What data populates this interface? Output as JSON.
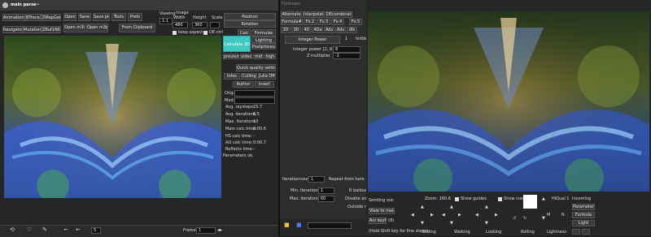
{
  "window": {
    "title": "main parse~"
  },
  "menu": [
    "Animations",
    "BTrace2",
    "ZMapGen",
    "Open",
    "Save",
    "Save pic",
    "Tools",
    "Prefs"
  ],
  "menu2": [
    "Navigator",
    "MutaGen",
    "ZBuf16Bit",
    "Open m3i",
    "Open m3p",
    "From Clipboard"
  ],
  "viewing": {
    "label": "Viewing",
    "zoom": "1:1",
    "image_label": "Image",
    "width_label": "Width",
    "width": "480",
    "height_label": "Height",
    "height": "360",
    "scale_label": "Scale",
    "keep_aspect": "keep aspect",
    "de_label": "DE:ctrl"
  },
  "side_tabs": [
    "Position",
    "Rotation",
    "Calc",
    "Formulas",
    "Lighting",
    "Postprocess"
  ],
  "calc_button": "Calculate 3D",
  "quality": [
    "preview",
    "video",
    "mid",
    "high"
  ],
  "quick_quality": "Quick quality settings",
  "sub_tabs": [
    "Infos",
    "Culling",
    "Julia Off"
  ],
  "author_btn": "Author",
  "insert_btn": "insert",
  "orig_label": "Orig:",
  "mod_label": "Mod:",
  "stats": [
    {
      "k": "Avg. raysteps:",
      "v": "23.7"
    },
    {
      "k": "Avg. iterations:",
      "v": "6.5"
    },
    {
      "k": "Max. iterations:",
      "v": "13"
    },
    {
      "k": "Main calc time:",
      "v": "0:00.6"
    },
    {
      "k": "HS calc time:",
      "v": "-"
    },
    {
      "k": "AO calc time:",
      "v": "0:00.7"
    },
    {
      "k": "Reflects time:",
      "v": "-"
    }
  ],
  "params_ok": "Parameters ok.",
  "frame_label": "Frame:",
  "frame_value": "1",
  "toolbar_value": "5",
  "formulas_window": {
    "title": "Formulas"
  },
  "formula_tabs": [
    "Alternate",
    "Interpolate",
    "DEcombinate"
  ],
  "formula_row2": [
    "Formula#",
    "Fo.2",
    "Fo.3",
    "Fo.4",
    "Fo.5"
  ],
  "formula_row3": [
    "3D",
    "3D",
    "4D",
    "4Da",
    "Ads",
    "Ads",
    "dlk"
  ],
  "formula_name": "Integer Power",
  "formula_num": "1",
  "hide_label": "hidde",
  "integer_power_label": "Integer power [2..9]",
  "integer_power": "8",
  "z_mult_label": "Z multiplier",
  "z_mult": "-1",
  "iter_count_label": "Iterationcount",
  "iter_count": "1",
  "repeat_label": "Repeat from here",
  "min_iter_label": "Min. iterations:",
  "min_iter": "1",
  "r_bailout": "R bailout",
  "max_iter_label": "Max. iterations:",
  "max_iter": "60",
  "disable_label": "Disable ana",
  "outside_label": "Outside r",
  "nav": {
    "sending_out": "Sending out:",
    "view_to_main": "View to main",
    "ani_keyfr": "Ani keyfr.",
    "ani_key_num": "(8)",
    "zoom_label": "Zoom: 160.6",
    "show_guides": "Show guides",
    "show_coords": "Show coords",
    "hi_qual": "HiQual 1",
    "incoming": "Incoming",
    "parameter": "Parameter",
    "formula": "Formula",
    "light": "Light",
    "hold_shift": "(Hold Shift key for fine steps)",
    "sliding": "Sliding",
    "walking": "Walking",
    "looking": "Looking",
    "rolling": "Rolling",
    "lightness": "Lightness",
    "m_label": "M",
    "n_label": "N"
  }
}
